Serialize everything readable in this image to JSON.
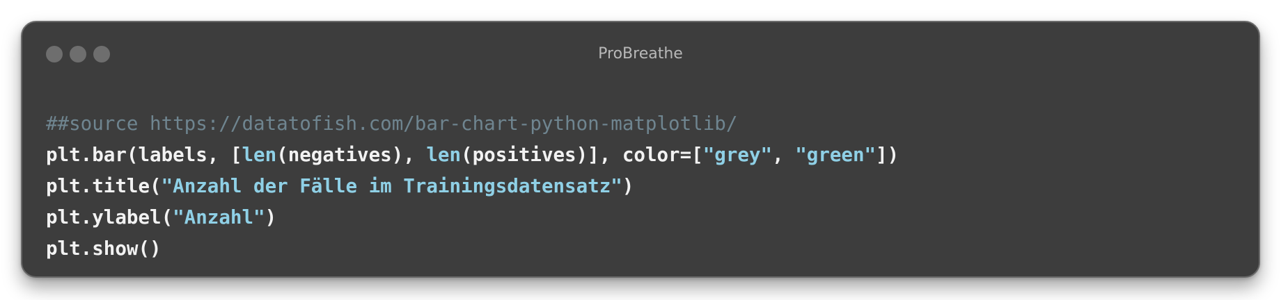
{
  "window": {
    "title": "ProBreathe",
    "controls": [
      "close-dot",
      "minimize-dot",
      "maximize-dot"
    ]
  },
  "colors": {
    "background": "#3d3d3d",
    "comment": "#6f8590",
    "plain": "#f2f2f2",
    "accent": "#8fd0e6"
  },
  "code": {
    "lines": [
      [
        {
          "type": "comment",
          "text": "##source https://datatofish.com/bar-chart-python-matplotlib/"
        }
      ],
      [
        {
          "type": "plain",
          "text": "plt.bar(labels, ["
        },
        {
          "type": "builtin",
          "text": "len"
        },
        {
          "type": "plain",
          "text": "(negatives), "
        },
        {
          "type": "builtin",
          "text": "len"
        },
        {
          "type": "plain",
          "text": "(positives)], color=["
        },
        {
          "type": "string",
          "text": "\"grey\""
        },
        {
          "type": "plain",
          "text": ", "
        },
        {
          "type": "string",
          "text": "\"green\""
        },
        {
          "type": "plain",
          "text": "])"
        }
      ],
      [
        {
          "type": "plain",
          "text": "plt.title("
        },
        {
          "type": "string",
          "text": "\"Anzahl der Fälle im Trainingsdatensatz\""
        },
        {
          "type": "plain",
          "text": ")"
        }
      ],
      [
        {
          "type": "plain",
          "text": "plt.ylabel("
        },
        {
          "type": "string",
          "text": "\"Anzahl\""
        },
        {
          "type": "plain",
          "text": ")"
        }
      ],
      [
        {
          "type": "plain",
          "text": "plt.show()"
        }
      ]
    ]
  }
}
